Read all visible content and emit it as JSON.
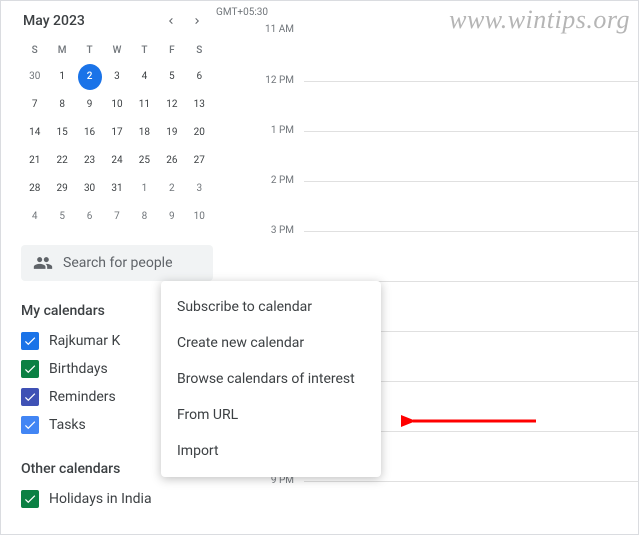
{
  "watermark": "www.wintips.org",
  "timezone": "GMT+05:30",
  "miniCalendar": {
    "title": "May 2023",
    "dow": [
      "S",
      "M",
      "T",
      "W",
      "T",
      "F",
      "S"
    ],
    "days": [
      {
        "n": "30",
        "out": true
      },
      {
        "n": "1"
      },
      {
        "n": "2",
        "today": true
      },
      {
        "n": "3"
      },
      {
        "n": "4"
      },
      {
        "n": "5"
      },
      {
        "n": "6"
      },
      {
        "n": "7"
      },
      {
        "n": "8"
      },
      {
        "n": "9"
      },
      {
        "n": "10"
      },
      {
        "n": "11"
      },
      {
        "n": "12"
      },
      {
        "n": "13"
      },
      {
        "n": "14"
      },
      {
        "n": "15"
      },
      {
        "n": "16"
      },
      {
        "n": "17"
      },
      {
        "n": "18"
      },
      {
        "n": "19"
      },
      {
        "n": "20"
      },
      {
        "n": "21"
      },
      {
        "n": "22"
      },
      {
        "n": "23"
      },
      {
        "n": "24"
      },
      {
        "n": "25"
      },
      {
        "n": "26"
      },
      {
        "n": "27"
      },
      {
        "n": "28"
      },
      {
        "n": "29"
      },
      {
        "n": "30"
      },
      {
        "n": "31"
      },
      {
        "n": "1",
        "out": true
      },
      {
        "n": "2",
        "out": true
      },
      {
        "n": "3",
        "out": true
      },
      {
        "n": "4",
        "out": true
      },
      {
        "n": "5",
        "out": true
      },
      {
        "n": "6",
        "out": true
      },
      {
        "n": "7",
        "out": true
      },
      {
        "n": "8",
        "out": true
      },
      {
        "n": "9",
        "out": true
      },
      {
        "n": "10",
        "out": true
      }
    ]
  },
  "search": {
    "placeholder": "Search for people"
  },
  "sections": {
    "my": "My calendars",
    "other": "Other calendars"
  },
  "myCalendars": [
    {
      "label": "Rajkumar K",
      "color": "#1a73e8",
      "checked": true
    },
    {
      "label": "Birthdays",
      "color": "#0b8043",
      "checked": true
    },
    {
      "label": "Reminders",
      "color": "#3f51b5",
      "checked": true
    },
    {
      "label": "Tasks",
      "color": "#4285f4",
      "checked": true
    }
  ],
  "otherCalendars": [
    {
      "label": "Holidays in India",
      "color": "#0b8043",
      "checked": true
    }
  ],
  "timeSlots": [
    "11 AM",
    "12 PM",
    "1 PM",
    "2 PM",
    "3 PM",
    "",
    "",
    "",
    "",
    "9 PM"
  ],
  "contextMenu": [
    "Subscribe to calendar",
    "Create new calendar",
    "Browse calendars of interest",
    "From URL",
    "Import"
  ]
}
